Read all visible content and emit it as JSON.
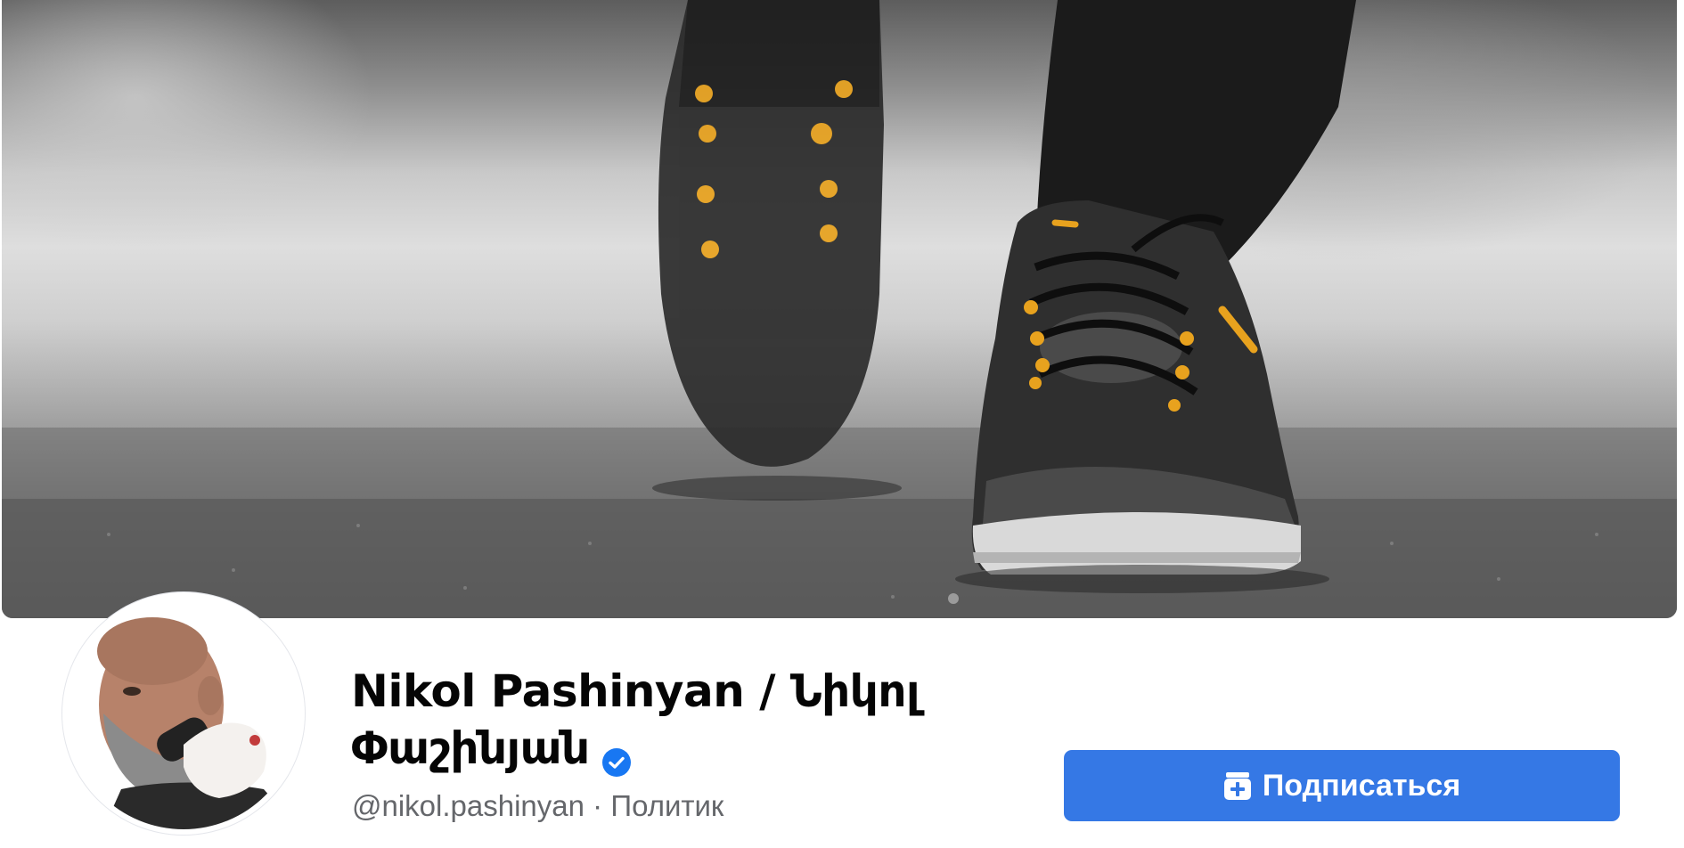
{
  "cover": {
    "icon": "cover-photo-sneakers"
  },
  "profile": {
    "avatar_icon": "profile-avatar",
    "name": "Nikol Pashinyan / Նիկոլ Փաշինյան",
    "verified_icon": "verified-badge-icon",
    "handle": "@nikol.pashinyan",
    "separator": "·",
    "category": "Политик"
  },
  "actions": {
    "follow_label": "Подписаться",
    "follow_icon": "subscribe-icon",
    "follow_color": "#3578e5"
  }
}
